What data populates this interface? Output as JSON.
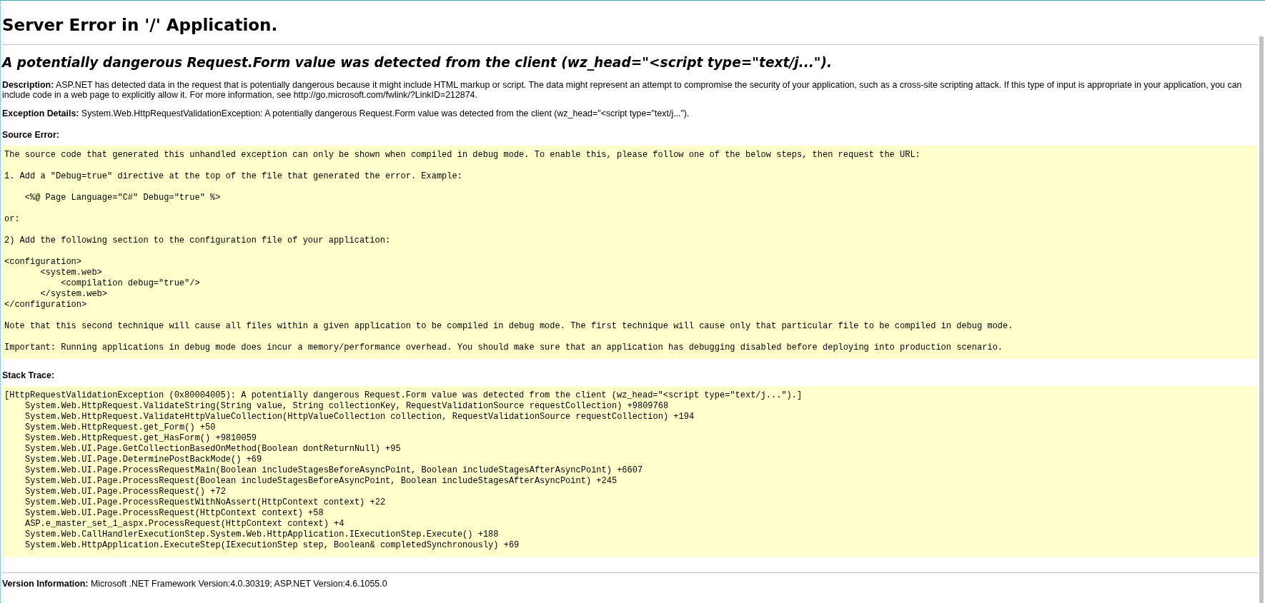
{
  "title": "Server Error in '/' Application.",
  "heading": "A potentially dangerous Request.Form value was detected from the client (wz_head=\"<script type=\"text/j...\").",
  "description": "**Description:** ASP.NET has detected data in the request that is potentially dangerous because it might include HTML markup or script. The data might represent an attempt to compromise the security of your application, such as a cross-site scripting attack. If this type of input is appropriate in your application, you can include code in a web page to explicitly allow it. For more information, see http://go.microsoft.com/fwlink/?LinkID=212874.",
  "exception_details": "**Exception Details:** System.Web.HttpRequestValidationException: A potentially dangerous Request.Form value was detected from the client (wz_head=\"<script type=\"text/j...\").",
  "source_error": {
    "label": "Source Error:",
    "blocks": [
      [
        "The source code that generated this unhandled exception can only be shown when compiled in debug mode. To enable this, please follow one of the below steps, then request the URL:"
      ],
      [
        "1. Add a \"Debug=true\" directive at the top of the file that generated the error. Example:"
      ],
      [
        "    <%@ Page Language=\"C#\" Debug=\"true\" %>"
      ],
      [
        "or:"
      ],
      [
        "2) Add the following section to the configuration file of your application:"
      ],
      [
        "<configuration>",
        "       <system.web>",
        "           <compilation debug=\"true\"/>",
        "       </system.web>",
        "</configuration>"
      ],
      [
        "Note that this second technique will cause all files within a given application to be compiled in debug mode. The first technique will cause only that particular file to be compiled in debug mode."
      ],
      [
        "Important: Running applications in debug mode does incur a memory/performance overhead. You should make sure that an application has debugging disabled before deploying into production scenario."
      ]
    ]
  },
  "stack_trace": {
    "label": "Stack Trace:",
    "exception": "[HttpRequestValidationException (0x80004005): A potentially dangerous Request.Form value was detected from the client (wz_head=\"<script type=\"text/j...\").]",
    "frames": [
      "System.Web.HttpRequest.ValidateString(String value, String collectionKey, RequestValidationSource requestCollection) +9809768",
      "System.Web.HttpRequest.ValidateHttpValueCollection(HttpValueCollection collection, RequestValidationSource requestCollection) +194",
      "System.Web.HttpRequest.get_Form() +50",
      "System.Web.HttpRequest.get_HasForm() +9810059",
      "System.Web.UI.Page.GetCollectionBasedOnMethod(Boolean dontReturnNull) +95",
      "System.Web.UI.Page.DeterminePostBackMode() +69",
      "System.Web.UI.Page.ProcessRequestMain(Boolean includeStagesBeforeAsyncPoint, Boolean includeStagesAfterAsyncPoint) +6607",
      "System.Web.UI.Page.ProcessRequest(Boolean includeStagesBeforeAsyncPoint, Boolean includeStagesAfterAsyncPoint) +245",
      "System.Web.UI.Page.ProcessRequest() +72",
      "System.Web.UI.Page.ProcessRequestWithNoAssert(HttpContext context) +22",
      "System.Web.UI.Page.ProcessRequest(HttpContext context) +58",
      "ASP.e_master_set_1_aspx.ProcessRequest(HttpContext context) +4",
      "System.Web.CallHandlerExecutionStep.System.Web.HttpApplication.IExecutionStep.Execute() +188",
      "System.Web.HttpApplication.ExecuteStep(IExecutionStep step, Boolean& completedSynchronously) +69"
    ]
  },
  "version_information": "**Version Information:** Microsoft .NET Framework Version:4.0.30319; ASP.NET Version:4.6.1055.0"
}
